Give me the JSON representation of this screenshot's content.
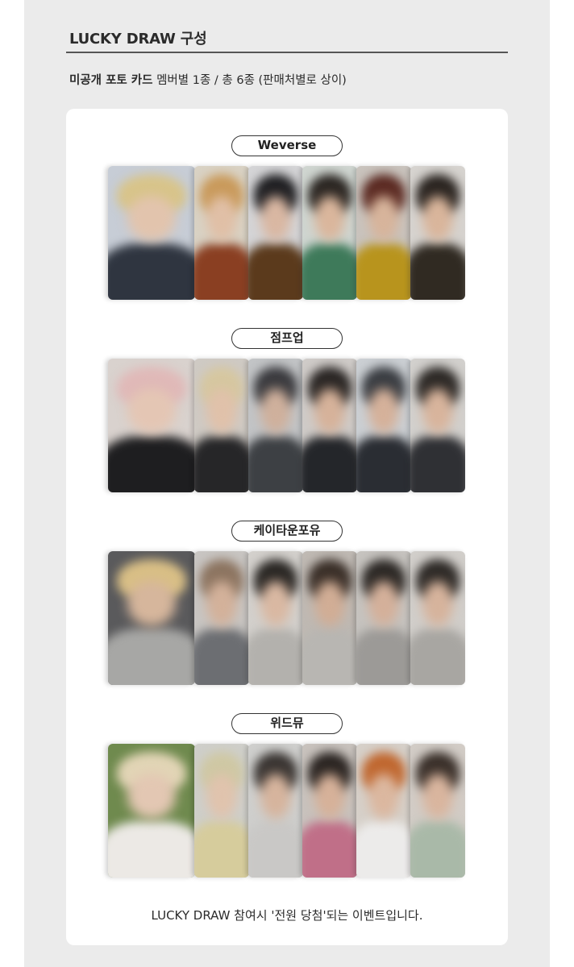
{
  "header": {
    "title": "LUCKY DRAW 구성",
    "subtitle_bold": "미공개 포토 카드",
    "subtitle_rest": " 멤버별 1종 / 총 6종 (판매처별로 상이)"
  },
  "groups": [
    {
      "label": "Weverse",
      "cards": [
        {
          "bg": "#c7cdd6",
          "hair": "#d8c48a",
          "face": "#e2c4ad",
          "body": "#2f3540"
        },
        {
          "bg": "#d9d2c4",
          "hair": "#c99a5b",
          "face": "#e0bfa6",
          "body": "#8a3f22"
        },
        {
          "bg": "#d4d4d6",
          "hair": "#1f1f22",
          "face": "#d9b7a2",
          "body": "#5b3a1c"
        },
        {
          "bg": "#cfd5d0",
          "hair": "#2b2622",
          "face": "#dab69c",
          "body": "#3e7a5a"
        },
        {
          "bg": "#c9c3bd",
          "hair": "#5b2a22",
          "face": "#d7b49b",
          "body": "#b8941d"
        },
        {
          "bg": "#d6d3cf",
          "hair": "#2a2420",
          "face": "#d9b59b",
          "body": "#302a22"
        }
      ]
    },
    {
      "label": "점프업",
      "cards": [
        {
          "bg": "#d9d2ce",
          "hair": "#e0b9b8",
          "face": "#e4c6b4",
          "body": "#1e1e20"
        },
        {
          "bg": "#cfcac4",
          "hair": "#d6c7a0",
          "face": "#e0c1aa",
          "body": "#262628"
        },
        {
          "bg": "#c2c4c6",
          "hair": "#3a3a3e",
          "face": "#cfb09c",
          "body": "#3d4044"
        },
        {
          "bg": "#cfcbc8",
          "hair": "#2a2624",
          "face": "#d6b29a",
          "body": "#24262a"
        },
        {
          "bg": "#cbcfd3",
          "hair": "#3a3d42",
          "face": "#d5b19a",
          "body": "#2a2d33"
        },
        {
          "bg": "#d2d0cd",
          "hair": "#2d2926",
          "face": "#d8b49c",
          "body": "#2f3034"
        }
      ]
    },
    {
      "label": "케이타운포유",
      "cards": [
        {
          "bg": "#5a5a5c",
          "hair": "#d9bf86",
          "face": "#d6b69c",
          "body": "#a7a7a5"
        },
        {
          "bg": "#c8c5c2",
          "hair": "#8c7460",
          "face": "#d3b19a",
          "body": "#6c6e72"
        },
        {
          "bg": "#d3d0cc",
          "hair": "#2a2724",
          "face": "#d9b8a2",
          "body": "#b3b1ad"
        },
        {
          "bg": "#bfb9b3",
          "hair": "#3a2f28",
          "face": "#d1ad95",
          "body": "#b8b6b2"
        },
        {
          "bg": "#c6c3bf",
          "hair": "#2c2825",
          "face": "#d4b09a",
          "body": "#9c9a97"
        },
        {
          "bg": "#d1ceca",
          "hair": "#2e2a27",
          "face": "#d6b39c",
          "body": "#a8a6a2"
        }
      ]
    },
    {
      "label": "위드뮤",
      "cards": [
        {
          "bg": "#6f8a4e",
          "hair": "#e2d5b6",
          "face": "#e3c7b3",
          "body": "#ece9e5"
        },
        {
          "bg": "#cfcfca",
          "hair": "#cfc8a4",
          "face": "#e0c3ad",
          "body": "#d6cc9c"
        },
        {
          "bg": "#cfcfcd",
          "hair": "#3a3532",
          "face": "#d6b49d",
          "body": "#c9c8c6"
        },
        {
          "bg": "#c8c2bd",
          "hair": "#2b2522",
          "face": "#d6b199",
          "body": "#c06f88"
        },
        {
          "bg": "#d6d0c9",
          "hair": "#c0672f",
          "face": "#dbb79f",
          "body": "#ecebea"
        },
        {
          "bg": "#d2ccc6",
          "hair": "#3a302a",
          "face": "#d9b59e",
          "body": "#a9b9a8"
        }
      ]
    }
  ],
  "footer": "LUCKY DRAW 참여시 '전원 당첨'되는 이벤트입니다."
}
